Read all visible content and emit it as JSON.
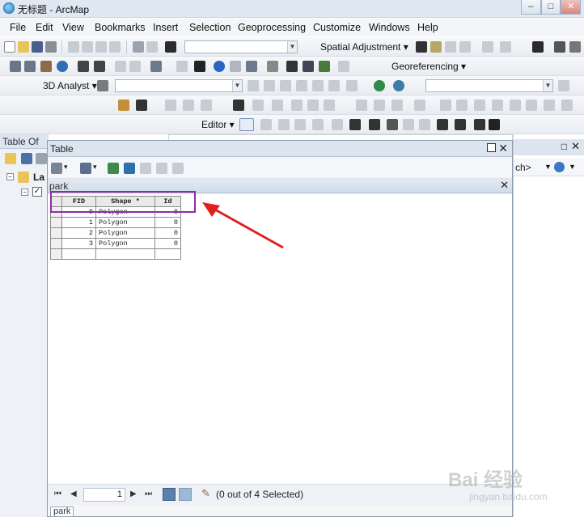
{
  "window": {
    "title": "无标题 - ArcMap",
    "minimize": "–",
    "maximize": "□",
    "close": "✕"
  },
  "menubar": [
    "File",
    "Edit",
    "View",
    "Bookmarks",
    "Insert",
    "Selection",
    "Geoprocessing",
    "Customize",
    "Windows",
    "Help"
  ],
  "toolbars": {
    "spatial_adjustment": "Spatial Adjustment ▾",
    "georeferencing": "Georeferencing ▾",
    "analyst_3d": "3D Analyst ▾",
    "editor": "Editor ▾"
  },
  "toc": {
    "title": "Table Of",
    "layer_label": "La"
  },
  "right_panel": {
    "search_hint": "ch>"
  },
  "table_window": {
    "title": "Table",
    "pin": "□",
    "close": "✕",
    "tab_name": "park",
    "tab_close": "✕",
    "columns": [
      "FID",
      "Shape *",
      "Id"
    ],
    "rows": [
      {
        "fid": "0",
        "shape": "Polygon",
        "id": "0"
      },
      {
        "fid": "1",
        "shape": "Polygon",
        "id": "0"
      },
      {
        "fid": "2",
        "shape": "Polygon",
        "id": "0"
      },
      {
        "fid": "3",
        "shape": "Polygon",
        "id": "0"
      }
    ],
    "record_number": "1",
    "status": "(0 out of 4 Selected)",
    "bottom_tab": "park"
  },
  "annotation": {
    "highlight_color": "#8e2ca5",
    "arrow_color": "#e02020"
  },
  "watermark": {
    "brand": "Bai 经验",
    "url": "jingyan.baidu.com"
  }
}
